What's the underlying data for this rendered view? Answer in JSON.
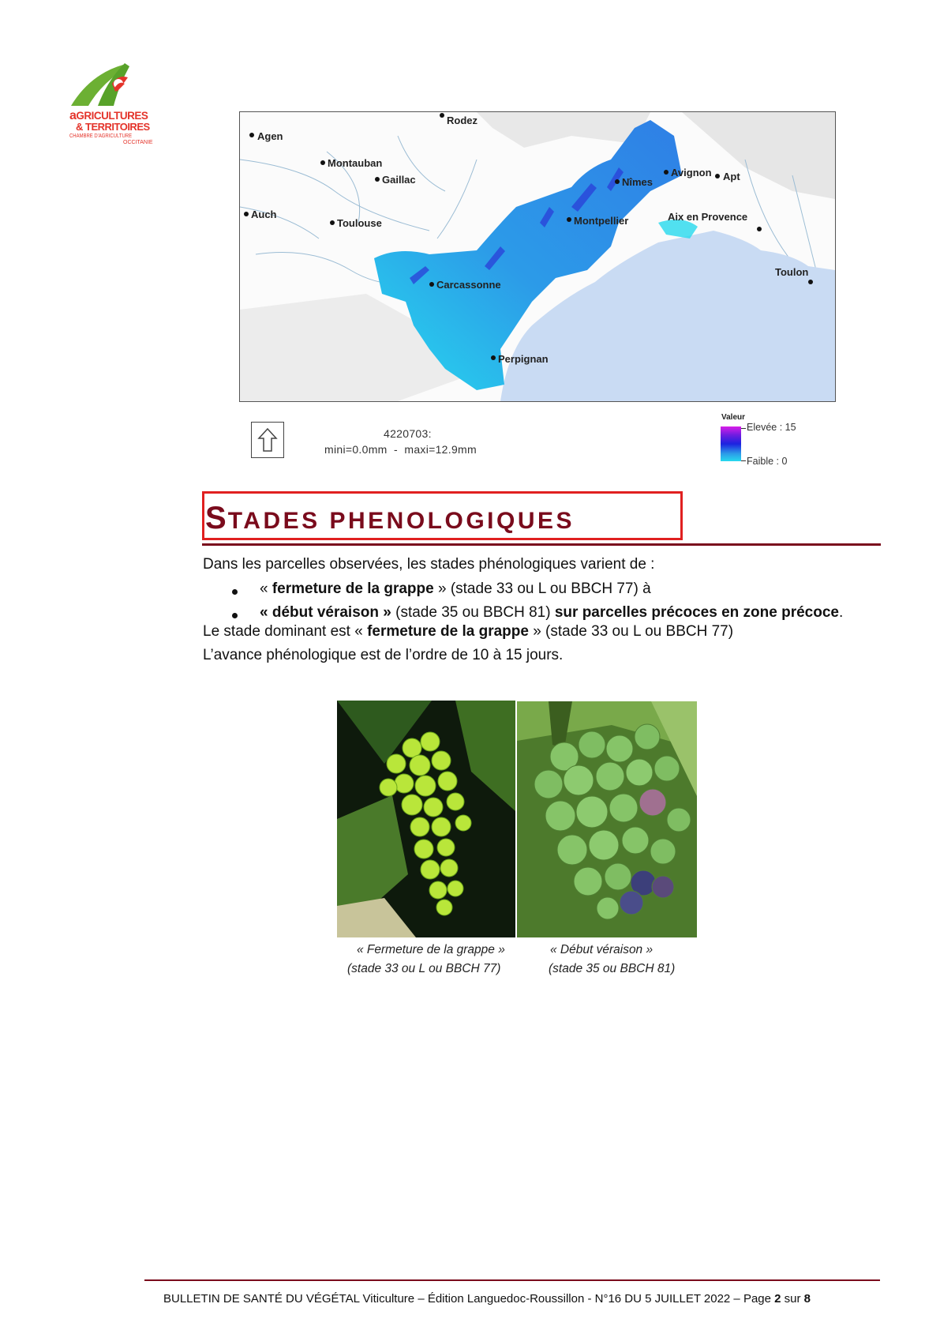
{
  "logo": {
    "line1_first": "a",
    "line1_rest": "GRICULTURES",
    "line2": "& TERRITOIRES",
    "line3": "CHAMBRE D'AGRICULTURE",
    "line4": "OCCITANIE"
  },
  "map": {
    "cities": [
      "Rodez",
      "Agen",
      "Montauban",
      "Gaillac",
      "Avignon",
      "Apt",
      "Nîmes",
      "Auch",
      "Toulouse",
      "Montpellier",
      "Aix en Provence",
      "Toulon",
      "Carcassonne",
      "Perpignan"
    ],
    "id_label": "4220703:",
    "range_label": "mini=0.0mm  -  maxi=12.9mm",
    "legend": {
      "title": "Valeur",
      "high": "Elevée : 15",
      "low": "Faible : 0",
      "colors": {
        "high": "#d91ee8",
        "mid": "#1c22e0",
        "low": "#27d9ee"
      }
    }
  },
  "section": {
    "title_first_letter": "S",
    "title_rest": "TADES PHENOLOGIQUES"
  },
  "body": {
    "intro": "Dans les parcelles observées, les stades phénologiques varient de :",
    "bullet1": {
      "open": "« ",
      "bold": "fermeture de la grappe",
      "rest": " » (stade 33 ou L ou BBCH 77) à"
    },
    "bullet2": {
      "bold1": "« début véraison »",
      "mid": " (stade 35 ou BBCH 81) ",
      "bold2": "sur parcelles précoces en zone précoce",
      "end": "."
    },
    "dominant": {
      "pre": "Le stade dominant est « ",
      "bold": "fermeture de la grappe",
      "post": " » (stade 33 ou L ou BBCH 77)"
    },
    "advance": "L’avance phénologique est de l’ordre de 10 à 15 jours."
  },
  "photos": {
    "left_caption_1": "« Fermeture de la grappe »",
    "left_caption_2": "(stade 33 ou L ou BBCH 77)",
    "right_caption_1": "« Début véraison »",
    "right_caption_2": "(stade 35 ou BBCH 81)"
  },
  "footer": {
    "pre": "BULLETIN DE SANTÉ DU VÉGÉTAL Viticulture – Édition Languedoc-Roussillon - N°16 DU 5 JUILLET 2022 – Page ",
    "page": "2",
    "mid": " sur ",
    "total": "8"
  }
}
